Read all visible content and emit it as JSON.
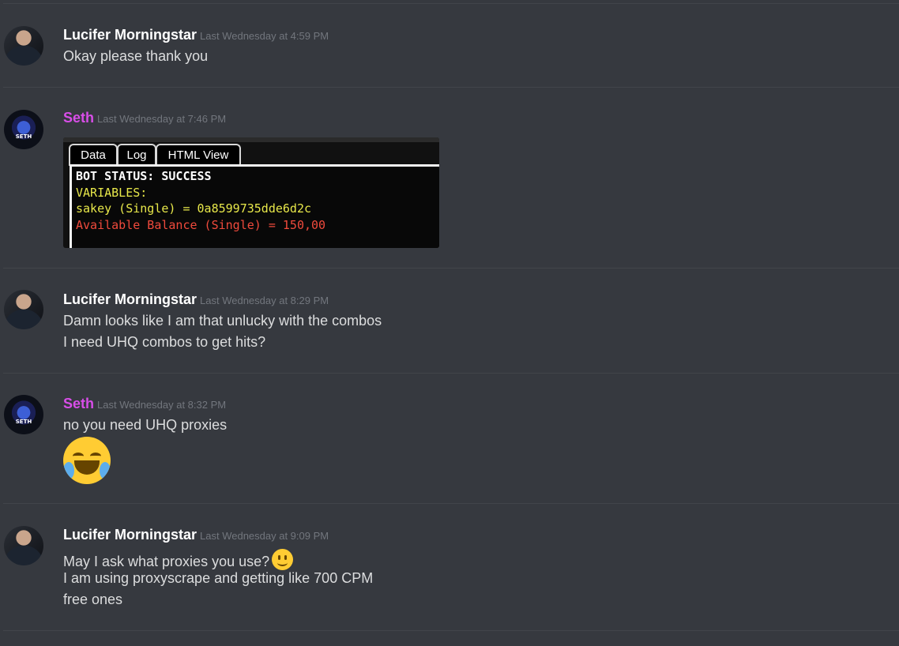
{
  "messages": [
    {
      "author": "Lucifer Morningstar",
      "timestamp": "Last Wednesday at 4:59 PM",
      "lines": [
        "Okay please thank you"
      ]
    },
    {
      "author": "Seth",
      "timestamp": "Last Wednesday at 7:46 PM",
      "attachment": {
        "tabs": [
          "Data",
          "Log",
          "HTML View"
        ],
        "lines": [
          "BOT STATUS: SUCCESS",
          "VARIABLES:",
          "sakey (Single) = 0a8599735dde6d2c",
          "Available Balance (Single) = 150,00"
        ]
      }
    },
    {
      "author": "Lucifer Morningstar",
      "timestamp": "Last Wednesday at 8:29 PM",
      "lines": [
        "Damn looks like I am that unlucky with the combos",
        "I need UHQ combos to get hits?"
      ]
    },
    {
      "author": "Seth",
      "timestamp": "Last Wednesday at 8:32 PM",
      "lines": [
        "no you need UHQ proxies"
      ],
      "emoji": "joy-emoji"
    },
    {
      "author": "Lucifer Morningstar",
      "timestamp": "Last Wednesday at 9:09 PM",
      "lines": [
        "May I ask what proxies you use?",
        "I am using proxyscrape and getting like 700 CPM",
        "free ones"
      ],
      "inline_emoji": "slightly-smiling-emoji"
    }
  ],
  "colors": {
    "background": "#36393f",
    "lucifer_name": "#ffffff",
    "seth_name": "#d84ee8",
    "timestamp": "#72767d",
    "message_text": "#dcddde"
  }
}
